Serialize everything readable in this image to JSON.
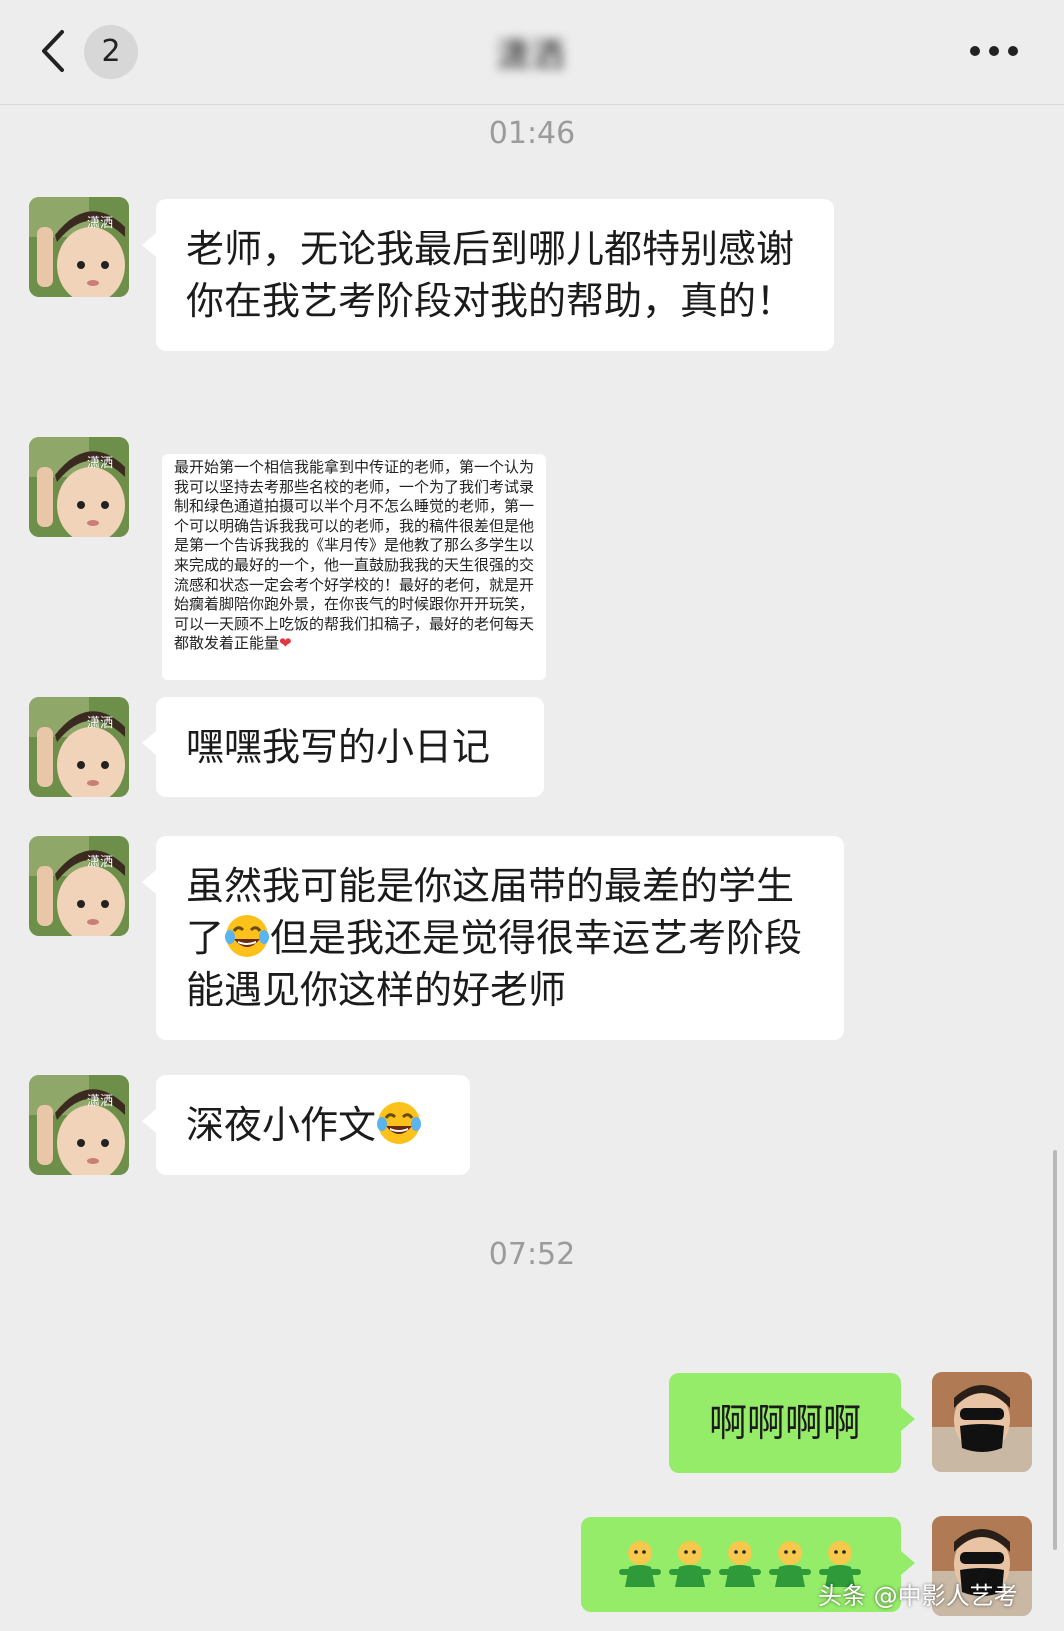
{
  "header": {
    "back_badge": "2",
    "title": "潇洒"
  },
  "timestamps": [
    "01:46",
    "07:52"
  ],
  "contact": {
    "avatar_label": "潇洒"
  },
  "messages": [
    {
      "text": "老师，无论我最后到哪儿都特别感谢你在我艺考阶段对我的帮助，真的！"
    },
    {
      "image_text": "最开始第一个相信我能拿到中传证的老师，第一个认为我可以坚持去考那些名校的老师，一个为了我们考试录制和绿色通道拍摄可以半个月不怎么睡觉的老师，第一个可以明确告诉我我可以的老师，我的稿件很差但是他是第一个告诉我我的《芈月传》是他教了那么多学生以来完成的最好的一个，他一直鼓励我我的天生很强的交流感和状态一定会考个好学校的！最好的老何，就是开始瘸着脚陪你跑外景，在你丧气的时候跟你开开玩笑，可以一天顾不上吃饭的帮我们扣稿子，最好的老何每天都散发着正能量",
      "image_heart": "❤"
    },
    {
      "text": "嘿嘿我写的小日记"
    },
    {
      "text_part1": "虽然我可能是你这届带的最差的学生了",
      "text_part2": "但是我还是觉得很幸运艺考阶段能遇见你这样的好老师"
    },
    {
      "text": "深夜小作文"
    },
    {
      "text": "啊啊啊啊",
      "sent": true
    }
  ],
  "emoji_names": [
    "laughing-tears-emoji",
    "green-figure-emoji"
  ],
  "watermark": "头条 @中影人艺考",
  "colors": {
    "background": "#ededed",
    "bubble_received": "#ffffff",
    "bubble_sent": "#95ec69",
    "timestamp": "#9b9b9b"
  }
}
